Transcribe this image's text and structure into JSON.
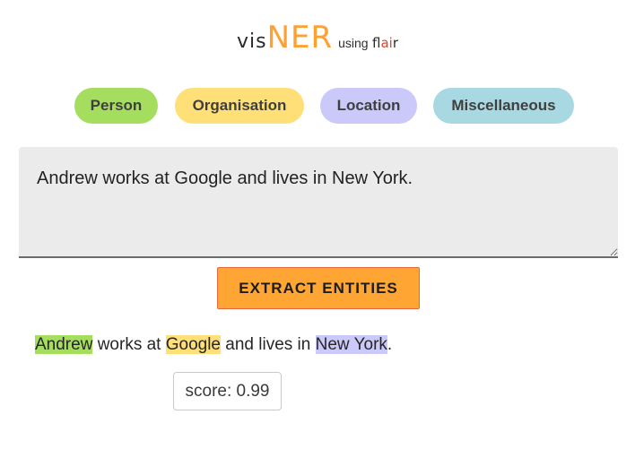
{
  "logo": {
    "vis": "vis",
    "ner": "NER",
    "using": "using",
    "flair_part1": "fl",
    "flair_part2": "ai",
    "flair_part3": "r"
  },
  "legend": {
    "person": "Person",
    "organisation": "Organisation",
    "location": "Location",
    "miscellaneous": "Miscellaneous"
  },
  "input": {
    "value": "Andrew works at Google and lives in New York."
  },
  "extract_button": {
    "label": "EXTRACT ENTITIES"
  },
  "result": {
    "entity_1": "Andrew",
    "text_1": " works at ",
    "entity_2": "Google",
    "text_2": " and lives in ",
    "entity_3": "New York",
    "text_3": "."
  },
  "score": {
    "text": "score: 0.99"
  },
  "colors": {
    "person": "#a5dd5e",
    "organisation": "#ffe078",
    "location": "#cac9f9",
    "miscellaneous": "#a8d9e3",
    "accent": "#ffa533"
  }
}
